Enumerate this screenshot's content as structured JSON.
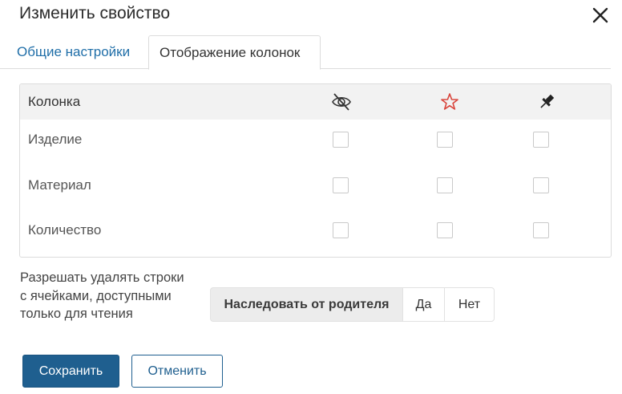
{
  "dialog": {
    "title": "Изменить свойство"
  },
  "tabs": [
    {
      "label": "Общие настройки",
      "active": false
    },
    {
      "label": "Отображение колонок",
      "active": true
    }
  ],
  "table": {
    "header": {
      "column_label": "Колонка",
      "icons": [
        "eye-off-icon",
        "star-icon",
        "pin-icon"
      ]
    },
    "rows": [
      {
        "label": "Изделие",
        "hidden": false,
        "required": false,
        "pinned": false
      },
      {
        "label": "Материал",
        "hidden": false,
        "required": false,
        "pinned": false
      },
      {
        "label": "Количество",
        "hidden": false,
        "required": false,
        "pinned": false
      }
    ]
  },
  "delete_option": {
    "label": "Разрешать удалять строки с ячейками, доступными только для чтения",
    "options": [
      "Наследовать от родителя",
      "Да",
      "Нет"
    ],
    "selected": "Наследовать от родителя"
  },
  "buttons": {
    "save": "Сохранить",
    "cancel": "Отменить"
  },
  "colors": {
    "accent": "#1f5f8f",
    "link": "#1f6ea8",
    "star": "#d9453c"
  }
}
